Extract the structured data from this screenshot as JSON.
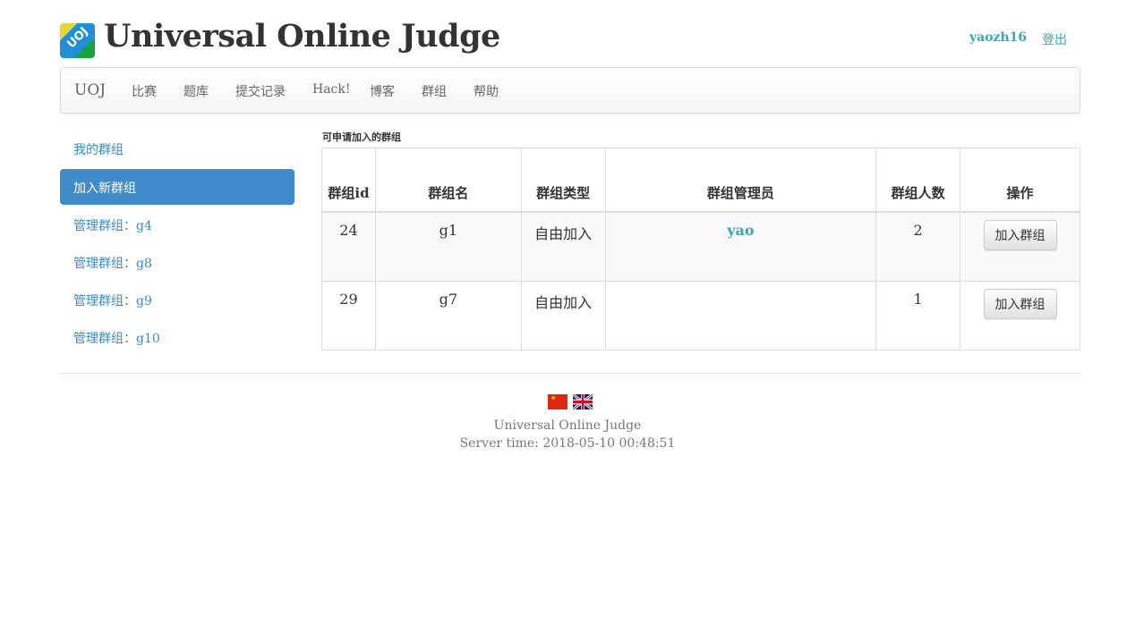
{
  "header": {
    "logo_text": "UOJ",
    "title": "Universal Online Judge",
    "username": "yaozh16",
    "logout": "登出"
  },
  "navbar": {
    "brand": "UOJ",
    "items": [
      "比赛",
      "题库",
      "提交记录",
      "Hack!",
      "博客",
      "群组",
      "帮助"
    ]
  },
  "sidebar": {
    "items": [
      {
        "label": "我的群组",
        "active": false
      },
      {
        "label": "加入新群组",
        "active": true
      },
      {
        "label": "管理群组：g4",
        "active": false
      },
      {
        "label": "管理群组：g8",
        "active": false
      },
      {
        "label": "管理群组：g9",
        "active": false
      },
      {
        "label": "管理群组：g10",
        "active": false
      }
    ]
  },
  "main": {
    "section_title": "可申请加入的群组",
    "columns": [
      "群组id",
      "群组名",
      "群组类型",
      "群组管理员",
      "群组人数",
      "操作"
    ],
    "rows": [
      {
        "id": "24",
        "name": "g1",
        "type": "自由加入",
        "admin": "yao",
        "members": "2",
        "action": "加入群组"
      },
      {
        "id": "29",
        "name": "g7",
        "type": "自由加入",
        "admin": "",
        "members": "1",
        "action": "加入群组"
      }
    ]
  },
  "footer": {
    "languages": [
      "中文",
      "English"
    ],
    "site_name": "Universal Online Judge",
    "server_time": "Server time: 2018-05-10 00:48:51"
  },
  "colors": {
    "link": "#3a8bc9",
    "accent_link": "#3aa7b5",
    "active_bg": "#428bca"
  }
}
